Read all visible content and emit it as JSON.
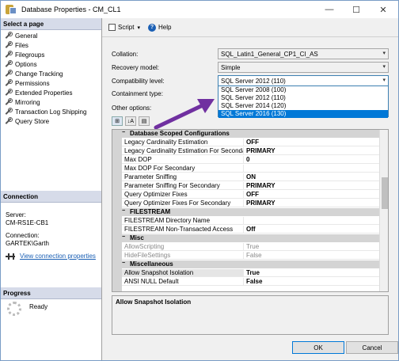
{
  "window": {
    "title": "Database Properties - CM_CL1",
    "minimize": "—",
    "maximize": "☐",
    "close": "✕"
  },
  "left": {
    "select_page_header": "Select a page",
    "pages": [
      "General",
      "Files",
      "Filegroups",
      "Options",
      "Change Tracking",
      "Permissions",
      "Extended Properties",
      "Mirroring",
      "Transaction Log Shipping",
      "Query Store"
    ],
    "connection_header": "Connection",
    "server_label": "Server:",
    "server_value": "CM-RS1E-CB1",
    "connection_label": "Connection:",
    "connection_value": "GARTEK\\Garth",
    "view_link": "View connection properties",
    "progress_header": "Progress",
    "progress_status": "Ready"
  },
  "toolbar": {
    "script_label": "Script",
    "script_caret": "▾",
    "help_label": "Help",
    "help_glyph": "?"
  },
  "form": {
    "collation_label": "Collation:",
    "collation_value": "SQL_Latin1_General_CP1_CI_AS",
    "recovery_label": "Recovery model:",
    "recovery_value": "Simple",
    "compat_label": "Compatibility level:",
    "compat_value": "SQL Server 2012 (110)",
    "containment_label": "Containment type:",
    "other_label": "Other options:",
    "chevron": "▾"
  },
  "dropdown_options": [
    "SQL Server 2008 (100)",
    "SQL Server 2012 (110)",
    "SQL Server 2014 (120)",
    "SQL Server 2016 (130)"
  ],
  "dropdown_selected_index": 3,
  "sort_buttons": {
    "categorized": "⊞",
    "alpha": "↓A",
    "pages": "▤"
  },
  "grid": {
    "rows": [
      {
        "type": "cat",
        "toggle": "−",
        "name": "Database Scoped Configurations"
      },
      {
        "type": "prop",
        "name": "Legacy Cardinality Estimation",
        "value": "OFF"
      },
      {
        "type": "prop",
        "name": "Legacy Cardinality Estimation For Secondary",
        "value": "PRIMARY"
      },
      {
        "type": "prop",
        "name": "Max DOP",
        "value": "0"
      },
      {
        "type": "prop",
        "name": "Max DOP For Secondary",
        "value": ""
      },
      {
        "type": "prop",
        "name": "Parameter Sniffing",
        "value": "ON"
      },
      {
        "type": "prop",
        "name": "Parameter Sniffing For Secondary",
        "value": "PRIMARY"
      },
      {
        "type": "prop",
        "name": "Query Optimizer Fixes",
        "value": "OFF"
      },
      {
        "type": "prop",
        "name": "Query Optimizer Fixes For Secondary",
        "value": "PRIMARY"
      },
      {
        "type": "cat",
        "toggle": "−",
        "name": "FILESTREAM"
      },
      {
        "type": "prop",
        "name": "FILESTREAM Directory Name",
        "value": ""
      },
      {
        "type": "prop",
        "name": "FILESTREAM Non-Transacted Access",
        "value": "Off"
      },
      {
        "type": "cat",
        "toggle": "−",
        "name": "Misc"
      },
      {
        "type": "prop",
        "dim": true,
        "name": "AllowScripting",
        "value": "True"
      },
      {
        "type": "prop",
        "dim": true,
        "name": "HideFileSettings",
        "value": "False"
      },
      {
        "type": "cat",
        "toggle": "−",
        "name": "Miscellaneous"
      },
      {
        "type": "prop",
        "selected": true,
        "name": "Allow Snapshot Isolation",
        "value": "True"
      },
      {
        "type": "prop",
        "name": "ANSI NULL Default",
        "value": "False"
      }
    ]
  },
  "description": "Allow Snapshot Isolation",
  "buttons": {
    "ok": "OK",
    "cancel": "Cancel"
  },
  "colors": {
    "accent": "#0078d7",
    "arrow": "#7030a0"
  }
}
